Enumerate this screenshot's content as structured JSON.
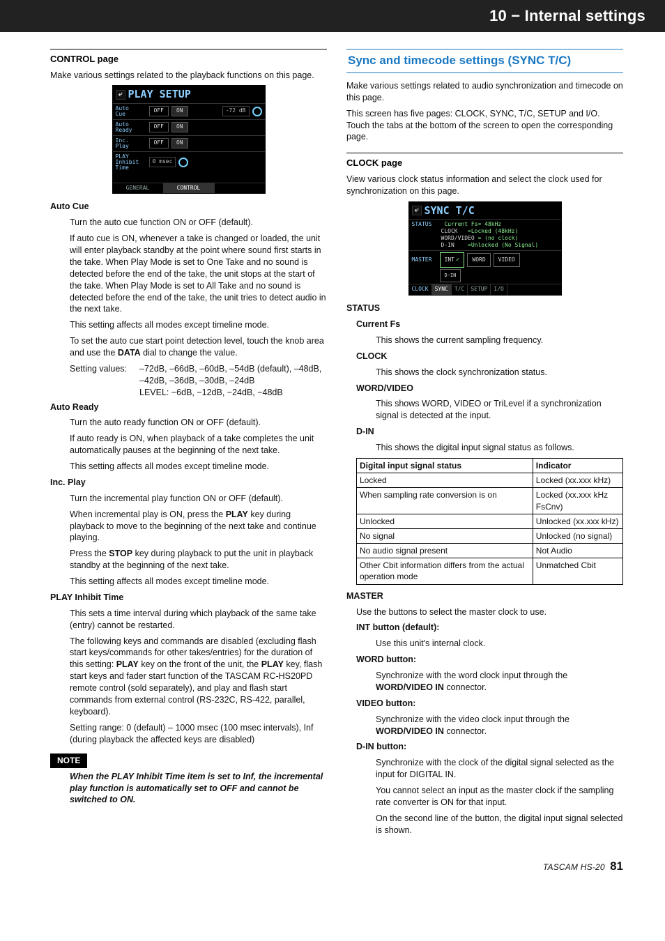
{
  "header": {
    "title": "10 − Internal settings"
  },
  "left": {
    "heading": "CONTROL page",
    "intro": "Make various settings related to the playback functions on this page.",
    "screen_play": {
      "title": "PLAY SETUP",
      "row1_label": "Auto\nCue",
      "off": "OFF",
      "on": "ON",
      "level_btn": "-72 dB",
      "row2_label": "Auto\nReady",
      "row3_label": "Inc.\nPlay",
      "row4_label": "PLAY\nInhibit\nTime",
      "row4_val": "0 msec",
      "tab_general": "GENERAL",
      "tab_control": "CONTROL"
    },
    "auto_cue": {
      "title": "Auto Cue",
      "p1": "Turn the auto cue function ON or OFF (default).",
      "p2": "If auto cue is ON, whenever a take is changed or loaded, the unit will enter playback standby at the point where sound first starts in the take. When Play Mode is set to One Take and no sound is detected before the end of the take, the unit stops at the start of the take. When Play Mode is set to All Take and no sound is detected before the end of the take, the unit tries to detect audio in the next take.",
      "p3": "This setting affects all modes except timeline mode.",
      "p4_a": "To set the auto cue start point detection level, touch the knob area and use the ",
      "p4_b": "DATA",
      "p4_c": " dial to change the value.",
      "set_label": "Setting values:",
      "set_v1": "–72dB, –66dB, –60dB, –54dB (default), –48dB, –42dB, –36dB, –30dB, –24dB",
      "set_v2": "LEVEL: −6dB, −12dB, −24dB, −48dB"
    },
    "auto_ready": {
      "title": "Auto Ready",
      "p1": "Turn the auto ready function ON or OFF (default).",
      "p2": "If auto ready is ON, when playback of a take completes the unit automatically pauses at the beginning of the next take.",
      "p3": "This setting affects all modes except timeline mode."
    },
    "inc_play": {
      "title": "Inc. Play",
      "p1": "Turn the incremental play function ON or OFF (default).",
      "p2_a": "When incremental play is ON, press the ",
      "p2_b": "PLAY",
      "p2_c": " key during playback to move to the beginning of the next take and continue playing.",
      "p3_a": "Press the ",
      "p3_b": "STOP",
      "p3_c": " key during playback to put the unit in playback standby at the beginning of the next take.",
      "p4": "This setting affects all modes except timeline mode."
    },
    "inhibit": {
      "title": "PLAY Inhibit Time",
      "p1": "This sets a time interval during which playback of the same take (entry) cannot be restarted.",
      "p2_a": "The following keys and commands are disabled (excluding flash start keys/commands for other takes/entries) for the duration of this setting: ",
      "p2_b": "PLAY",
      "p2_c": " key on the front of the unit, the ",
      "p2_d": "PLAY",
      "p2_e": " key, flash start keys and fader start function of the TASCAM RC-HS20PD remote control (sold separately), and play and flash start commands from external control (RS-232C, RS-422, parallel, keyboard).",
      "p3": "Setting range: 0 (default) – 1000 msec (100 msec intervals), Inf (during playback the affected keys are disabled)"
    },
    "note": {
      "label": "NOTE",
      "body": "When the PLAY Inhibit Time item is set to Inf, the incremental play function is automatically set to OFF and cannot be switched to ON."
    }
  },
  "right": {
    "feature_heading": "Sync and timecode settings (SYNC T/C)",
    "intro1": "Make various settings related to audio synchronization and timecode on this page.",
    "intro2": "This screen has five pages: CLOCK, SYNC, T/C, SETUP and I/O. Touch the tabs at the bottom of the screen to open the corresponding page.",
    "clock_heading": "CLOCK page",
    "clock_intro": "View various clock status information and select the clock used for synchronization on this page.",
    "screen_sync": {
      "title": "SYNC T/C",
      "status_label": "STATUS",
      "l1": "Current Fs= 48kHz",
      "l2a": "CLOCK",
      "l2b": "=Locked (48kHz)",
      "l3a": "WORD/VIDEO",
      "l3b": "= (no clock)",
      "l4a": "D-IN",
      "l4b": "=Unlocked (No Signal)",
      "master_label": "MASTER",
      "btn_int": "INT",
      "btn_word": "WORD",
      "btn_video": "VIDEO",
      "din_label": "D-IN",
      "tab_lbl": "CLOCK",
      "tab_sync": "SYNC",
      "tab_tc": "T/C",
      "tab_setup": "SETUP",
      "tab_io": "I/O"
    },
    "status": {
      "heading": "STATUS",
      "cfs_t": "Current Fs",
      "cfs_p": "This shows the current sampling frequency.",
      "clock_t": "CLOCK",
      "clock_p": "This shows the clock synchronization status.",
      "wv_t": "WORD/VIDEO",
      "wv_p": "This shows WORD, VIDEO or TriLevel if a synchronization signal is detected at the input.",
      "din_t": "D-IN",
      "din_p": "This shows the digital input signal status as follows."
    },
    "table": {
      "h1": "Digital input signal status",
      "h2": "Indicator",
      "r1a": "Locked",
      "r1b": "Locked (xx.xxx kHz)",
      "r2a": "When sampling rate conversion is on",
      "r2b": "Locked (xx.xxx kHz FsCnv)",
      "r3a": "Unlocked",
      "r3b": "Unlocked (xx.xxx kHz)",
      "r4a": "No signal",
      "r4b": "Unlocked (no signal)",
      "r5a": "No audio signal present",
      "r5b": "Not Audio",
      "r6a": "Other Cbit information differs from the actual operation mode",
      "r6b": "Unmatched Cbit"
    },
    "master": {
      "heading": "MASTER",
      "intro": "Use the buttons to select the master clock to use.",
      "int_t": "INT button (default):",
      "int_p": "Use this unit's internal clock.",
      "word_t": "WORD button:",
      "word_p_a": "Synchronize with the word clock input through the ",
      "word_p_b": "WORD/VIDEO IN",
      "word_p_c": " connector.",
      "video_t": "VIDEO button:",
      "video_p_a": "Synchronize with the video clock input through the ",
      "video_p_b": "WORD/VIDEO IN",
      "video_p_c": " connector.",
      "din_t": "D-IN button:",
      "din_p1": "Synchronize with the clock of the digital signal selected as the input for DIGITAL IN.",
      "din_p2": "You cannot select an input as the master clock if the sampling rate converter is ON for that input.",
      "din_p3": "On the second line of the button, the digital input signal selected is shown."
    }
  },
  "footer": {
    "model": "TASCAM HS-20",
    "page": "81"
  }
}
